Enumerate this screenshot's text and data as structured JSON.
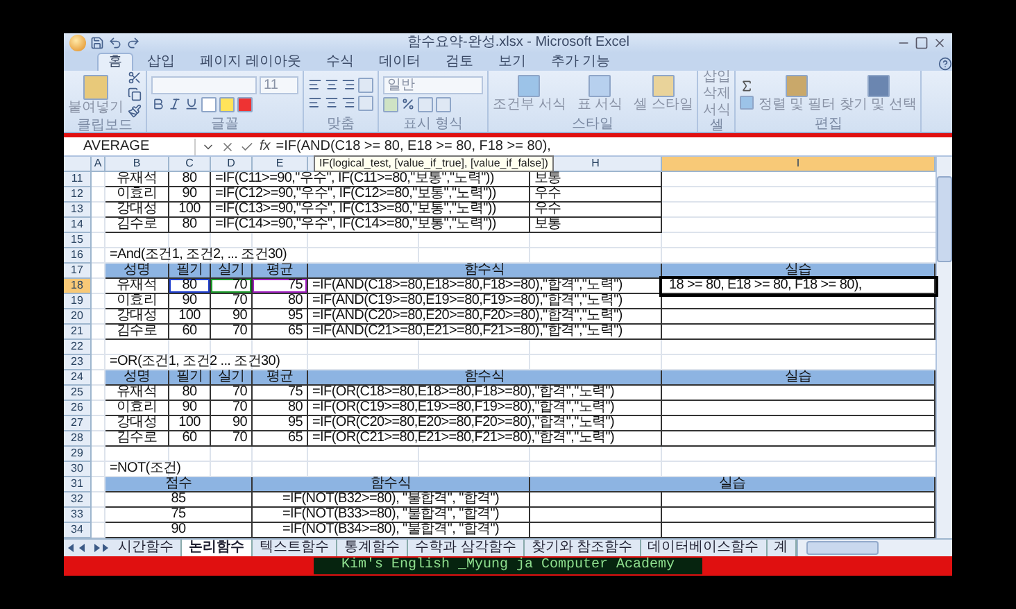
{
  "window": {
    "title": "함수요약-완성.xlsx - Microsoft Excel"
  },
  "ribbon_tabs": [
    {
      "label": "홈",
      "selected": true
    },
    {
      "label": "삽입",
      "selected": false
    },
    {
      "label": "페이지 레이아웃",
      "selected": false
    },
    {
      "label": "수식",
      "selected": false
    },
    {
      "label": "데이터",
      "selected": false
    },
    {
      "label": "검토",
      "selected": false
    },
    {
      "label": "보기",
      "selected": false
    },
    {
      "label": "추가 기능",
      "selected": false
    }
  ],
  "ribbon_groups": [
    {
      "kind": "clipboard",
      "label": "클립보드",
      "buttons": [
        "붙여넣기"
      ]
    },
    {
      "kind": "font",
      "label": "글꼴",
      "value": "11"
    },
    {
      "kind": "alignment",
      "label": "맞춤"
    },
    {
      "kind": "number",
      "label": "표시 형식",
      "value": "일반"
    },
    {
      "kind": "styles",
      "label": "스타일",
      "buttons": [
        "조건부 서식",
        "표 서식",
        "셀 스타일"
      ]
    },
    {
      "kind": "cells",
      "label": "셀",
      "buttons": [
        "삽입",
        "삭제",
        "서식"
      ]
    },
    {
      "kind": "editing",
      "label": "편집",
      "buttons": [
        "정렬 및 필터",
        "찾기 및 선택"
      ]
    }
  ],
  "formula_bar": {
    "name_box": "AVERAGE",
    "fx_label": "fx",
    "formula": "=IF(AND(C18 >= 80, E18 >= 80, F18 >= 80),",
    "tooltip": "IF(logical_test, [value_if_true], [value_if_false])"
  },
  "column_headers": [
    {
      "label": "A",
      "selected": false
    },
    {
      "label": "B",
      "selected": false
    },
    {
      "label": "C",
      "selected": false
    },
    {
      "label": "D",
      "selected": false
    },
    {
      "label": "E",
      "selected": false
    },
    {
      "label": "H",
      "selected": false
    },
    {
      "label": "I",
      "selected": true
    }
  ],
  "rows": [
    {
      "number": "11",
      "kind": "if",
      "selected": false,
      "cells": [
        "유재석",
        "80",
        "=IF(C11>=90,\"우수\", IF(C11>=80,\"보통\",\"노력\"))",
        "보통"
      ]
    },
    {
      "number": "12",
      "kind": "if",
      "selected": false,
      "cells": [
        "이효리",
        "90",
        "=IF(C12>=90,\"우수\", IF(C12>=80,\"보통\",\"노력\"))",
        "우수"
      ]
    },
    {
      "number": "13",
      "kind": "if",
      "selected": false,
      "cells": [
        "강대성",
        "100",
        "=IF(C13>=90,\"우수\", IF(C13>=80,\"보통\",\"노력\"))",
        "우수"
      ]
    },
    {
      "number": "14",
      "kind": "if",
      "selected": false,
      "cells": [
        "김수로",
        "80",
        "=IF(C14>=90,\"우수\", IF(C14>=80,\"보통\",\"노력\"))",
        "보통"
      ]
    },
    {
      "number": "15",
      "kind": "blank",
      "selected": false
    },
    {
      "number": "16",
      "kind": "title",
      "selected": false,
      "cells": [
        "=And(조건1, 조건2, ... 조건30)"
      ]
    },
    {
      "number": "17",
      "kind": "header5",
      "selected": false,
      "cells": [
        "성명",
        "필기",
        "실기",
        "평균",
        "함수식",
        "실습"
      ]
    },
    {
      "number": "18",
      "kind": "data5",
      "selected": true,
      "editing": true,
      "cells": [
        "유재석",
        "80",
        "70",
        "75",
        "=IF(AND(C18>=80,E18>=80,F18>=80),\"합격\",\"노력\")",
        "18 >= 80, E18 >= 80, F18 >= 80),"
      ]
    },
    {
      "number": "19",
      "kind": "data5",
      "selected": false,
      "editing": false,
      "cells": [
        "이효리",
        "90",
        "70",
        "80",
        "=IF(AND(C19>=80,E19>=80,F19>=80),\"합격\",\"노력\")"
      ]
    },
    {
      "number": "20",
      "kind": "data5",
      "selected": false,
      "editing": false,
      "cells": [
        "강대성",
        "100",
        "90",
        "95",
        "=IF(AND(C20>=80,E20>=80,F20>=80),\"합격\",\"노력\")"
      ]
    },
    {
      "number": "21",
      "kind": "data5",
      "selected": false,
      "editing": false,
      "cells": [
        "김수로",
        "60",
        "70",
        "65",
        "=IF(AND(C21>=80,E21>=80,F21>=80),\"합격\",\"노력\")"
      ]
    },
    {
      "number": "22",
      "kind": "blank",
      "selected": false
    },
    {
      "number": "23",
      "kind": "title",
      "selected": false,
      "cells": [
        "=OR(조건1, 조건2 ... 조건30)"
      ]
    },
    {
      "number": "24",
      "kind": "header5",
      "selected": false,
      "cells": [
        "성명",
        "필기",
        "실기",
        "평균",
        "함수식",
        "실습"
      ]
    },
    {
      "number": "25",
      "kind": "data5",
      "selected": false,
      "editing": false,
      "cells": [
        "유재석",
        "80",
        "70",
        "75",
        "=IF(OR(C18>=80,E18>=80,F18>=80),\"합격\",\"노력\")"
      ]
    },
    {
      "number": "26",
      "kind": "data5",
      "selected": false,
      "editing": false,
      "cells": [
        "이효리",
        "90",
        "70",
        "80",
        "=IF(OR(C19>=80,E19>=80,F19>=80),\"합격\",\"노력\")"
      ]
    },
    {
      "number": "27",
      "kind": "data5",
      "selected": false,
      "editing": false,
      "cells": [
        "강대성",
        "100",
        "90",
        "95",
        "=IF(OR(C20>=80,E20>=80,F20>=80),\"합격\",\"노력\")"
      ]
    },
    {
      "number": "28",
      "kind": "data5",
      "selected": false,
      "editing": false,
      "cells": [
        "김수로",
        "60",
        "70",
        "65",
        "=IF(OR(C21>=80,E21>=80,F21>=80),\"합격\",\"노력\")"
      ]
    },
    {
      "number": "29",
      "kind": "blank",
      "selected": false
    },
    {
      "number": "30",
      "kind": "title",
      "selected": false,
      "cells": [
        "=NOT(조건)"
      ]
    },
    {
      "number": "31",
      "kind": "header3",
      "selected": false,
      "cells": [
        "점수",
        "함수식",
        "실습"
      ]
    },
    {
      "number": "32",
      "kind": "data3",
      "selected": false,
      "cells": [
        "85",
        "=IF(NOT(B32>=80), \"불합격\", \"합격\")"
      ]
    },
    {
      "number": "33",
      "kind": "data3",
      "selected": false,
      "cells": [
        "75",
        "=IF(NOT(B33>=80), \"불합격\", \"합격\")"
      ]
    },
    {
      "number": "34",
      "kind": "data3",
      "selected": false,
      "cells": [
        "90",
        "=IF(NOT(B34>=80), \"불합격\", \"합격\")"
      ]
    }
  ],
  "sheet_tabs": [
    {
      "label": "시간함수",
      "selected": false
    },
    {
      "label": "논리함수",
      "selected": true
    },
    {
      "label": "텍스트함수",
      "selected": false
    },
    {
      "label": "통계함수",
      "selected": false
    },
    {
      "label": "수학과 삼각함수",
      "selected": false
    },
    {
      "label": "찾기와 참조함수",
      "selected": false
    },
    {
      "label": "데이터베이스함수",
      "selected": false
    },
    {
      "label": "계",
      "selected": false
    }
  ],
  "status_bar": {
    "caption": "Kim's English _Myung ja Computer Academy"
  }
}
